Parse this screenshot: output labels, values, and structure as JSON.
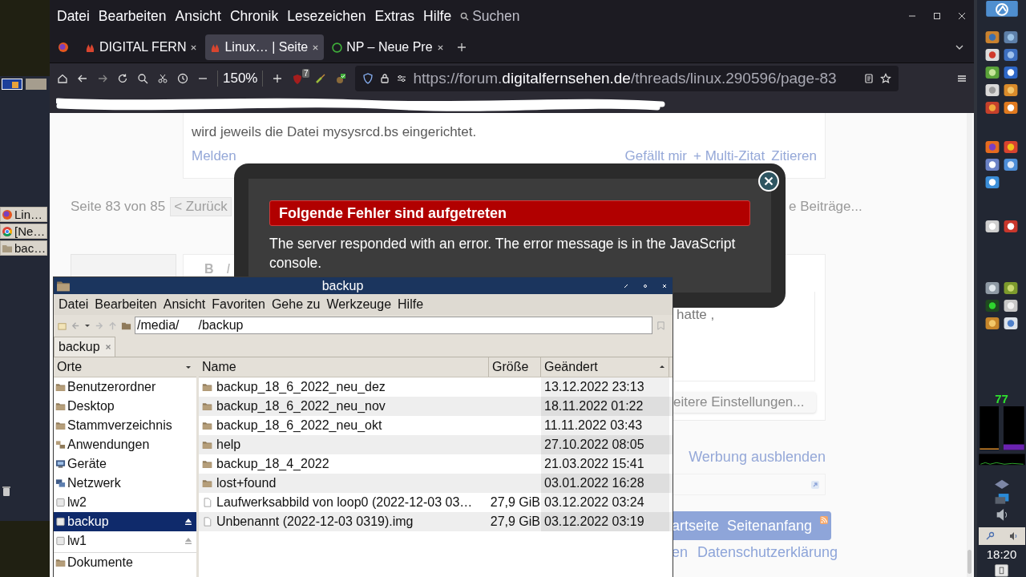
{
  "left_panel": {
    "workspaces": [
      {
        "selected": true
      },
      {
        "selected": false
      }
    ],
    "tasks": [
      {
        "label": "Lin…",
        "kind": "firefox"
      },
      {
        "label": "[Ne…",
        "kind": "chrome"
      },
      {
        "label": "bac…",
        "kind": "folder"
      }
    ]
  },
  "browser": {
    "menu": [
      "Datei",
      "Bearbeiten",
      "Ansicht",
      "Chronik",
      "Lesezeichen",
      "Extras",
      "Hilfe"
    ],
    "search": "Suchen",
    "tabs": [
      {
        "label": "DIGITAL FERN",
        "kind": "forum",
        "selected": false
      },
      {
        "label": "Linux… | Seite",
        "kind": "forum",
        "selected": true
      },
      {
        "label": "NP – Neue Pre",
        "kind": "news",
        "selected": false
      }
    ],
    "badge": "7",
    "zoom": "150%",
    "url": {
      "prefix": "https://forum.",
      "domain": "digitalfernsehen.de",
      "path": "/threads/linux.290596/page-83"
    }
  },
  "page": {
    "post_text": "wird jeweils die Datei mysysrcd.bs eingerichtet.",
    "report": "Melden",
    "actions": [
      "Gefällt mir",
      "+ Multi-Zitat",
      "Zitieren"
    ],
    "pagination": {
      "label": "Seite 83 von 85",
      "back": "< Zurück",
      "more": "e Beiträge..."
    },
    "editor": {
      "tools": [
        "B",
        "I"
      ],
      "text": "hatte ,",
      "settings": "eitere Einstellungen..."
    },
    "hide_ads": "Werbung ausblenden",
    "footer_nav": [
      "artseite",
      "Seitenanfang"
    ],
    "footer_links": [
      "en",
      "Datenschutzerklärung"
    ]
  },
  "error_dialog": {
    "title": "Folgende Fehler sind aufgetreten",
    "message": "The server responded with an error. The error message is in the JavaScript console."
  },
  "file_manager": {
    "title": "backup",
    "menu": [
      "Datei",
      "Bearbeiten",
      "Ansicht",
      "Favoriten",
      "Gehe zu",
      "Werkzeuge",
      "Hilfe"
    ],
    "path": [
      "/media/",
      "/backup"
    ],
    "tab": "backup",
    "places_title": "Orte",
    "places": [
      {
        "label": "Benutzerordner",
        "kind": "folder",
        "selected": false,
        "eject": false
      },
      {
        "label": "Desktop",
        "kind": "folder",
        "selected": false,
        "eject": false
      },
      {
        "label": "Stammverzeichnis",
        "kind": "folder",
        "selected": false,
        "eject": false
      },
      {
        "label": "Anwendungen",
        "kind": "apps",
        "selected": false,
        "eject": false
      },
      {
        "label": "Geräte",
        "kind": "computer",
        "selected": false,
        "eject": false
      },
      {
        "label": "Netzwerk",
        "kind": "network",
        "selected": false,
        "eject": false
      },
      {
        "label": "lw2",
        "kind": "drive",
        "selected": false,
        "eject": false
      },
      {
        "label": "backup",
        "kind": "drive",
        "selected": true,
        "eject": true
      },
      {
        "label": "lw1",
        "kind": "drive",
        "selected": false,
        "eject": true
      },
      {
        "label": "Dokumente",
        "kind": "folder",
        "selected": false,
        "eject": false
      }
    ],
    "columns": [
      "Name",
      "Größe",
      "Geändert"
    ],
    "rows": [
      {
        "name": "backup_18_6_2022_neu_dez",
        "kind": "folder",
        "modified": "13.12.2022 23:13"
      },
      {
        "name": "backup_18_6_2022_neu_nov",
        "kind": "folder",
        "modified": "18.11.2022 01:22"
      },
      {
        "name": "backup_18_6_2022_neu_okt",
        "kind": "folder",
        "modified": "11.11.2022 03:43"
      },
      {
        "name": "help",
        "kind": "folder",
        "modified": "27.10.2022 08:05"
      },
      {
        "name": "backup_18_4_2022",
        "kind": "folder",
        "modified": "21.03.2022 15:41"
      },
      {
        "name": "lost+found",
        "kind": "folder",
        "modified": "03.01.2022 16:28"
      },
      {
        "name": "Laufwerksabbild von loop0 (2022-12-03 03…",
        "kind": "file",
        "size": "27,9 GiB",
        "modified": "03.12.2022 03:24"
      },
      {
        "name": "Unbenannt (2022-12-03 0319).img",
        "kind": "file",
        "size": "27,9 GiB",
        "modified": "03.12.2022 03:19"
      }
    ]
  },
  "right_panel": {
    "cpu_reading": "77",
    "clock": "18:20"
  }
}
